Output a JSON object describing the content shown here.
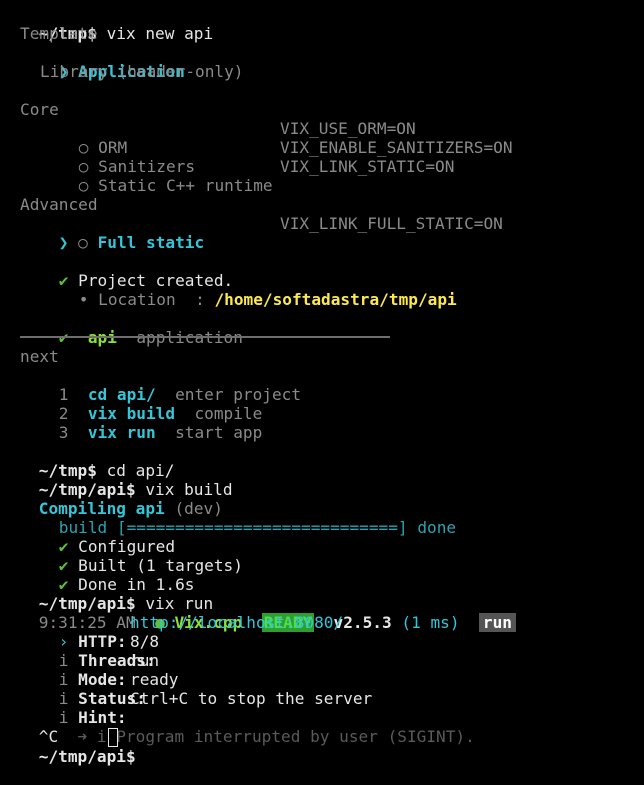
{
  "prompt_home": "~/tmp$",
  "prompt_api": "~/tmp/api$",
  "cmd_new": " vix new api",
  "wizard": {
    "template_header": "Template",
    "template_selected_marker": "❯",
    "template_selected": "Application",
    "template_other": "Library (header-only)",
    "core_header": "Core",
    "radio": "○",
    "core_options": [
      {
        "label": "ORM",
        "flag": "VIX_USE_ORM=ON"
      },
      {
        "label": "Sanitizers",
        "flag": "VIX_ENABLE_SANITIZERS=ON"
      },
      {
        "label": "Static C++ runtime",
        "flag": "VIX_LINK_STATIC=ON"
      }
    ],
    "advanced_header": "Advanced",
    "advanced_option": {
      "label": "Full static",
      "flag": "VIX_LINK_FULL_STATIC=ON"
    }
  },
  "created": {
    "check": "✔",
    "message": "Project created.",
    "bullet": "•",
    "location_label": "Location  :",
    "location_value": "/home/softadastra/tmp/api",
    "project_name": "api",
    "project_kind": "application"
  },
  "next": {
    "header": "next",
    "steps": [
      {
        "num": "1",
        "cmd": "cd api/",
        "desc": "enter project"
      },
      {
        "num": "2",
        "cmd": "vix build",
        "desc": "compile"
      },
      {
        "num": "3",
        "cmd": "vix run",
        "desc": "start app"
      }
    ]
  },
  "cmd_cd": " cd api/",
  "cmd_build": " vix build",
  "build": {
    "compiling": "Compiling api",
    "mode": "(dev)",
    "label": "build",
    "bar": "[============================]",
    "status": "done",
    "steps": [
      "Configured",
      "Built (1 targets)",
      "Done in 1.6s"
    ]
  },
  "cmd_run": " vix run",
  "run": {
    "time": "9:31:25 AM",
    "dot": "●",
    "app": "Vix.cpp",
    "ready": "READY",
    "version": "v2.5.3",
    "latency": "(1 ms)",
    "mode_badge": "run",
    "info": [
      {
        "marker": "›",
        "key": "HTTP:",
        "value": "http://localhost:8080/"
      },
      {
        "marker": "i",
        "key": "Threads:",
        "value": "8/8"
      },
      {
        "marker": "i",
        "key": "Mode:",
        "value": "run"
      },
      {
        "marker": "i",
        "key": "Status:",
        "value": "ready"
      },
      {
        "marker": "i",
        "key": "Hint:",
        "value": "Ctrl+C to stop the server"
      }
    ],
    "interrupt_ctrl": "^C",
    "interrupt_msg": "➜ i Program interrupted by user (SIGINT)."
  }
}
